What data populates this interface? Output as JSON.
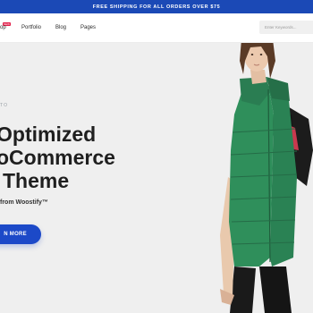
{
  "announcement": {
    "text": "FREE SHIPPING FOR ALL ORDERS OVER $75"
  },
  "nav": {
    "shop_label": "op",
    "shop_badge": "NEW",
    "items": [
      {
        "label": "Portfolio"
      },
      {
        "label": "Blog"
      },
      {
        "label": "Pages"
      }
    ]
  },
  "search": {
    "placeholder": "Enter Keywords..."
  },
  "hero": {
    "eyebrow": "TO",
    "headline_lines": [
      "Optimized",
      "oCommerce",
      "Theme"
    ],
    "byline": "from Woostify™",
    "cta_label": "N MORE"
  },
  "colors": {
    "accent": "#1b49b6",
    "button": "#1c49c8",
    "badge": "#e11d48",
    "hero_bg": "#efefef",
    "vest": "#2f8f5b"
  }
}
